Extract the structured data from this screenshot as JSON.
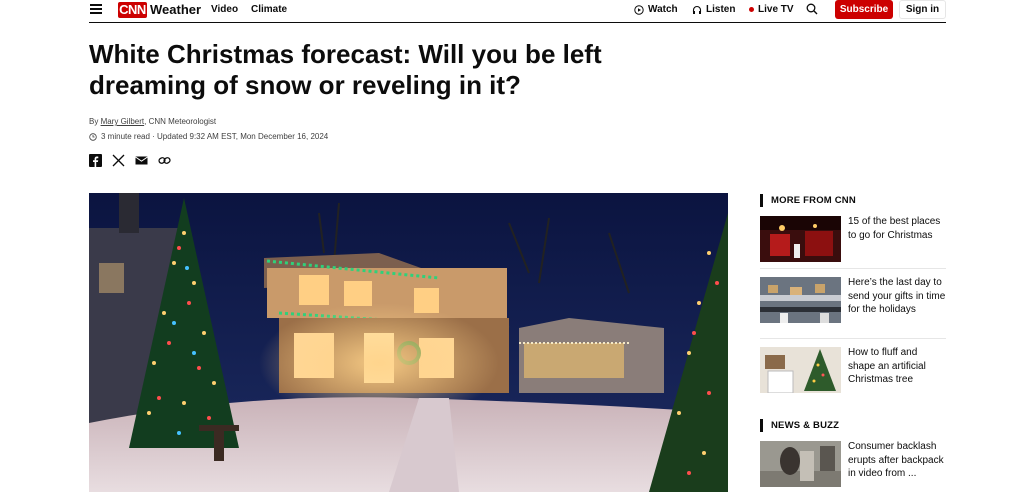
{
  "header": {
    "brand_logo": "CNN",
    "brand_label": "Weather",
    "nav": [
      "Video",
      "Climate"
    ],
    "watch_label": "Watch",
    "listen_label": "Listen",
    "live_label": "Live TV",
    "subscribe_label": "Subscribe",
    "signin_label": "Sign in",
    "accent_color": "#cc0000"
  },
  "article": {
    "headline": "White Christmas forecast: Will you be left dreaming of snow or reveling in it?",
    "byline_prefix": "By ",
    "author": "Mary Gilbert",
    "author_title": ", CNN Meteorologist",
    "timestamp": "3 minute read · Updated 9:32 AM EST, Mon December 16, 2024",
    "share_icons": [
      "facebook-icon",
      "x-icon",
      "email-icon",
      "link-icon"
    ]
  },
  "sidebar": {
    "more_heading": "MORE FROM CNN",
    "more_items": [
      {
        "title": "15 of the best places to go for Christmas"
      },
      {
        "title": "Here’s the last day to send your gifts in time for the holidays"
      },
      {
        "title": "How to fluff and shape an artificial Christmas tree"
      }
    ],
    "news_heading": "NEWS & BUZZ",
    "news_items": [
      {
        "title": "Consumer backlash erupts after backpack in video from ..."
      }
    ]
  }
}
